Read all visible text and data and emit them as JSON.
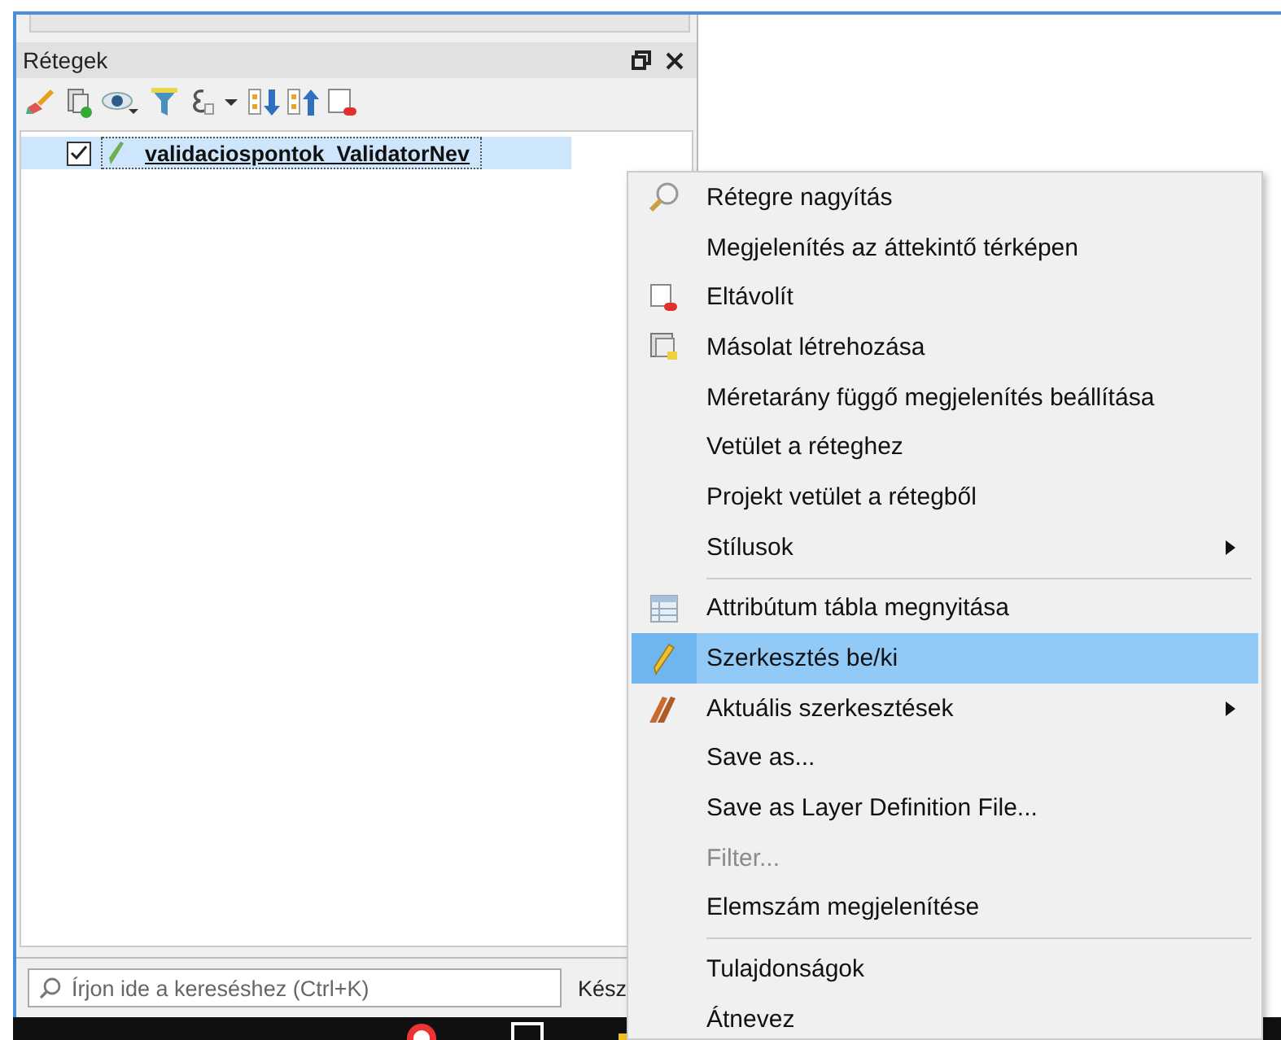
{
  "panel": {
    "title": "Rétegek"
  },
  "layers": [
    {
      "name": "validaciospontok_ValidatorNev",
      "checked": true,
      "selected": true
    }
  ],
  "search": {
    "placeholder": "Írjon ide a kereséshez (Ctrl+K)"
  },
  "status": "Kész",
  "context_menu": {
    "items": [
      {
        "kind": "item",
        "label": "Rétegre nagyítás",
        "submenu": false,
        "disabled": false,
        "selected": false
      },
      {
        "kind": "item",
        "label": "Megjelenítés az áttekintő térképen",
        "submenu": false,
        "disabled": false,
        "selected": false
      },
      {
        "kind": "item",
        "label": "Eltávolít",
        "submenu": false,
        "disabled": false,
        "selected": false
      },
      {
        "kind": "item",
        "label": "Másolat létrehozása",
        "submenu": false,
        "disabled": false,
        "selected": false
      },
      {
        "kind": "item",
        "label": "Méretarány függő megjelenítés beállítása",
        "submenu": false,
        "disabled": false,
        "selected": false
      },
      {
        "kind": "item",
        "label": "Vetület a réteghez",
        "submenu": false,
        "disabled": false,
        "selected": false
      },
      {
        "kind": "item",
        "label": "Projekt vetület a rétegből",
        "submenu": false,
        "disabled": false,
        "selected": false
      },
      {
        "kind": "item",
        "label": "Stílusok",
        "submenu": true,
        "disabled": false,
        "selected": false
      },
      {
        "kind": "separator"
      },
      {
        "kind": "item",
        "label": "Attribútum tábla megnyitása",
        "submenu": false,
        "disabled": false,
        "selected": false
      },
      {
        "kind": "item",
        "label": "Szerkesztés be/ki",
        "submenu": false,
        "disabled": false,
        "selected": true
      },
      {
        "kind": "item",
        "label": "Aktuális szerkesztések",
        "submenu": true,
        "disabled": false,
        "selected": false
      },
      {
        "kind": "item",
        "label": "Save as...",
        "submenu": false,
        "disabled": false,
        "selected": false
      },
      {
        "kind": "item",
        "label": "Save as Layer Definition File...",
        "submenu": false,
        "disabled": false,
        "selected": false
      },
      {
        "kind": "item",
        "label": "Filter...",
        "submenu": false,
        "disabled": true,
        "selected": false
      },
      {
        "kind": "item",
        "label": "Elemszám megjelenítése",
        "submenu": false,
        "disabled": false,
        "selected": false
      },
      {
        "kind": "separator"
      },
      {
        "kind": "item",
        "label": "Tulajdonságok",
        "submenu": false,
        "disabled": false,
        "selected": false
      },
      {
        "kind": "item",
        "label": "Átnevez",
        "submenu": false,
        "disabled": false,
        "selected": false
      }
    ]
  }
}
